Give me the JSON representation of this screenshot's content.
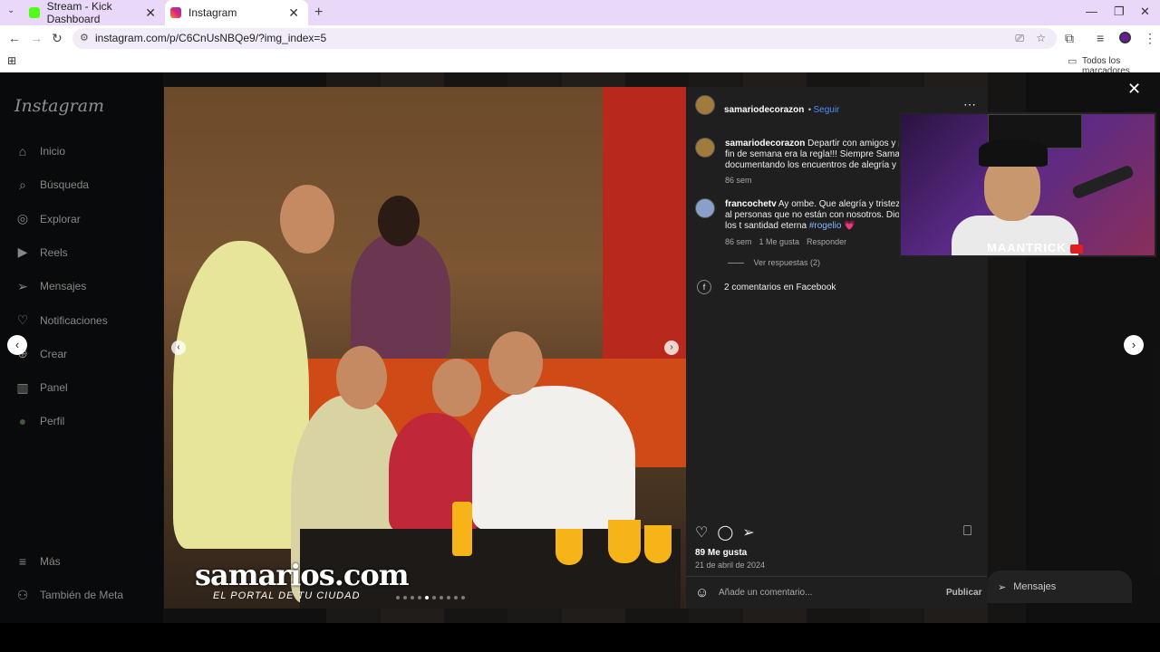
{
  "browser": {
    "tabs": [
      {
        "label": "Stream - Kick Dashboard",
        "active": false
      },
      {
        "label": "Instagram",
        "active": true
      }
    ],
    "url": "instagram.com/p/C6CnUsNBQe9/?img_index=5",
    "bookmarks_label": "Todos los marcadores"
  },
  "instagram": {
    "logo": "Instagram",
    "nav": [
      {
        "label": "Inicio",
        "icon": "home-icon"
      },
      {
        "label": "Búsqueda",
        "icon": "search-icon"
      },
      {
        "label": "Explorar",
        "icon": "compass-icon"
      },
      {
        "label": "Reels",
        "icon": "reels-icon"
      },
      {
        "label": "Mensajes",
        "icon": "messages-icon"
      },
      {
        "label": "Notificaciones",
        "icon": "heart-icon"
      },
      {
        "label": "Crear",
        "icon": "plus-icon"
      },
      {
        "label": "Panel",
        "icon": "chart-icon"
      },
      {
        "label": "Perfil",
        "icon": "avatar-icon"
      }
    ],
    "more_label": "Más",
    "meta_label": "También de Meta"
  },
  "photo": {
    "watermark": "samarios.com",
    "watermark_sub": "EL PORTAL DE TU CIUDAD",
    "carousel_count": 10,
    "carousel_index": 5
  },
  "post": {
    "author": "samariodecorazon",
    "follow_label": "Seguir",
    "caption_author": "samariodecorazon",
    "caption_text": "Departir con amigos y pasarla bien cada fin de semana era la regla!!! Siempre Samarios.com documentando los encuentros de alegría y amistad.",
    "caption_time": "86 sem",
    "comment": {
      "author": "francochetv",
      "text": "Ay ombe. Que alegría y tristeza al personas que no están con nosotros. Dios los t santidad eterna",
      "hashtag": "#rogelio",
      "emoji": "💗",
      "time": "86 sem",
      "likes": "1 Me gusta",
      "reply": "Responder",
      "view_replies": "Ver respuestas (2)"
    },
    "facebook_comments": "2 comentarios en Facebook",
    "likes": "89 Me gusta",
    "date": "21 de abril de 2024",
    "comment_placeholder": "Añade un comentario...",
    "publish_label": "Publicar"
  },
  "stream_overlay": {
    "name": "MAANTRICK"
  },
  "messages_label": "Mensajes"
}
